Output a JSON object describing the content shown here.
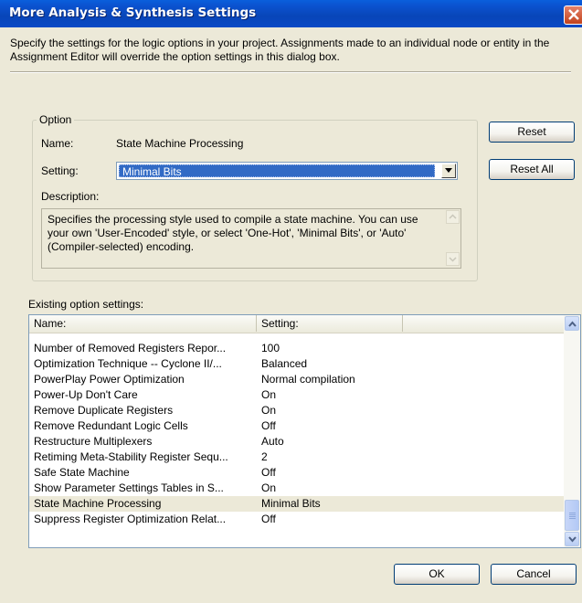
{
  "window": {
    "title": "More Analysis & Synthesis Settings"
  },
  "intro": "Specify the settings for the logic options in your project.  Assignments made to an individual node or entity in the Assignment Editor will override the option settings in this dialog box.",
  "option": {
    "group_label": "Option",
    "name_label": "Name:",
    "name_value": "State Machine Processing",
    "setting_label": "Setting:",
    "setting_value": "Minimal Bits",
    "description_label": "Description:",
    "description": "Specifies the processing style used to compile a state machine. You can use your own 'User-Encoded' style, or select 'One-Hot', 'Minimal Bits', or 'Auto' (Compiler-selected) encoding."
  },
  "buttons": {
    "reset": "Reset",
    "reset_all": "Reset All",
    "ok": "OK",
    "cancel": "Cancel"
  },
  "existing": {
    "label": "Existing option settings:",
    "col_name": "Name:",
    "col_setting": "Setting:",
    "rows": [
      {
        "name": "Number of Removed Registers Repor...",
        "setting": "100"
      },
      {
        "name": "Optimization Technique -- Cyclone II/...",
        "setting": "Balanced"
      },
      {
        "name": "PowerPlay Power Optimization",
        "setting": "Normal compilation"
      },
      {
        "name": "Power-Up Don't Care",
        "setting": "On"
      },
      {
        "name": "Remove Duplicate Registers",
        "setting": "On"
      },
      {
        "name": "Remove Redundant Logic Cells",
        "setting": "Off"
      },
      {
        "name": "Restructure Multiplexers",
        "setting": "Auto"
      },
      {
        "name": "Retiming Meta-Stability Register Sequ...",
        "setting": "2"
      },
      {
        "name": "Safe State Machine",
        "setting": "Off"
      },
      {
        "name": "Show Parameter Settings Tables in S...",
        "setting": "On"
      },
      {
        "name": "State Machine Processing",
        "setting": "Minimal Bits"
      },
      {
        "name": "Suppress Register Optimization Relat...",
        "setting": "Off"
      }
    ],
    "selected_index": 10
  },
  "icons": {
    "close": "close-icon",
    "dropdown": "chevron-down-icon",
    "scroll_up": "arrow-up-icon",
    "scroll_down": "arrow-down-icon"
  }
}
